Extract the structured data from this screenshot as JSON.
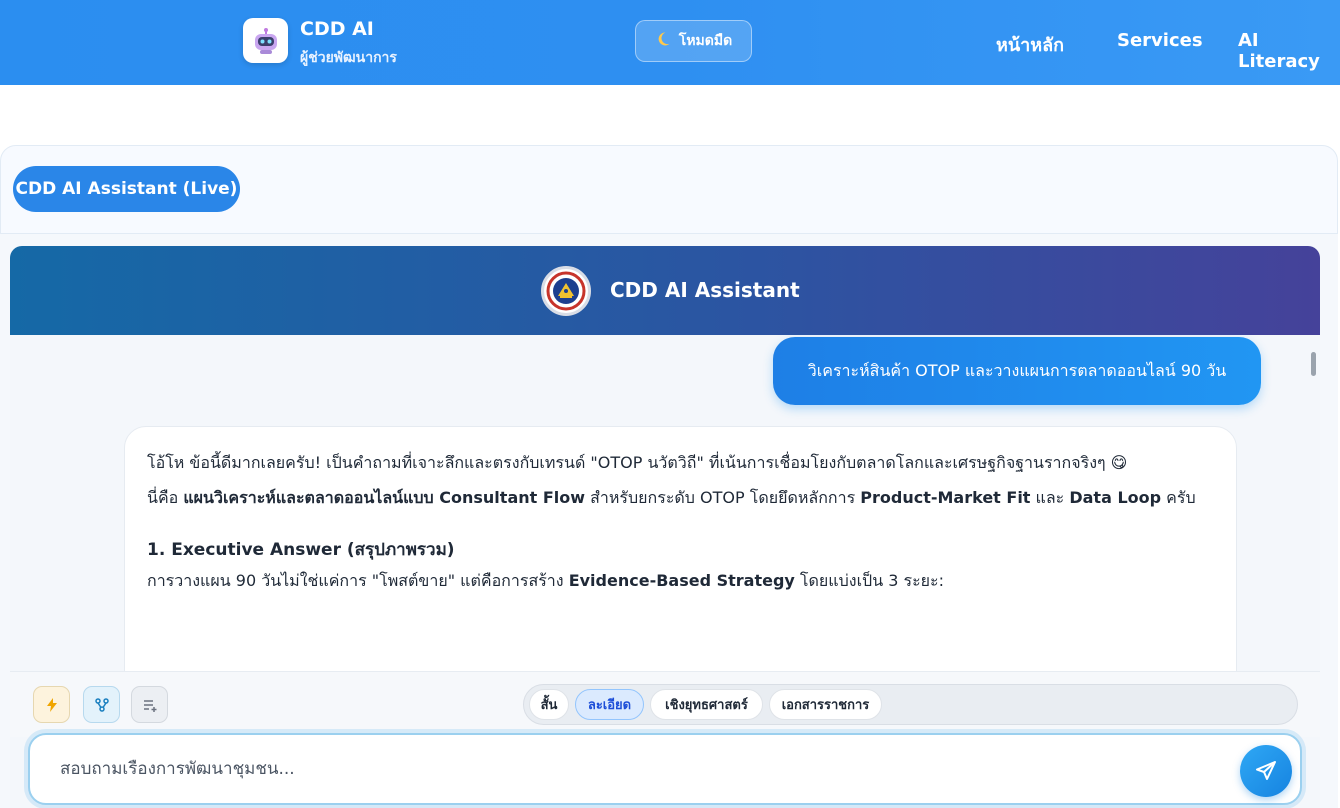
{
  "nav": {
    "brand_title": "CDD AI",
    "brand_subtitle": "ผู้ช่วยพัฒนาการ",
    "dark_mode_label": "โหมดมืด",
    "links": [
      "หน้าหลัก",
      "Services",
      "AI Literacy"
    ]
  },
  "page": {
    "live_pill": "CDD AI Assistant (Live)"
  },
  "chat": {
    "assistant_name": "CDD AI Assistant",
    "user_message": "วิเคราะห์สินค้า OTOP และวางแผนการตลาดออนไลน์ 90 วัน",
    "ai": {
      "p1": "โอ้โห ข้อนี้ดีมากเลยครับ! เป็นคำถามที่เจาะลึกและตรงกับเทรนด์ \"OTOP นวัตวิถี\" ที่เน้นการเชื่อมโยงกับตลาดโลกและเศรษฐกิจฐานรากจริงๆ 😋",
      "p2_a": "นี่คือ ",
      "p2_b": "แผนวิเคราะห์และตลาดออนไลน์แบบ Consultant Flow",
      "p2_c": " สำหรับยกระดับ OTOP โดยยึดหลักการ ",
      "p2_d": "Product-Market Fit",
      "p2_e": " และ ",
      "p2_f": "Data Loop",
      "p2_g": " ครับ",
      "h1": "1. Executive Answer (สรุปภาพรวม)",
      "p3_a": "การวางแผน 90 วันไม่ใช่แค่การ \"โพสต์ขาย\" แต่คือการสร้าง ",
      "p3_b": "Evidence-Based Strategy",
      "p3_c": " โดยแบ่งเป็น 3 ระยะ:"
    }
  },
  "toolbar": {
    "modes": [
      "สั้น",
      "ละเอียด",
      "เชิงยุทธศาสตร์",
      "เอกสารราชการ"
    ],
    "active_mode": "ละเอียด",
    "icons": [
      "bolt-icon",
      "branch-icon",
      "list-add-icon"
    ]
  },
  "input": {
    "placeholder": "สอบถามเรื่องการพัฒนาชุมชน..."
  },
  "colors": {
    "header_blue": "#2e8ff1",
    "accent": "#2196f3",
    "chat_header_start": "#1569a6",
    "chat_header_end": "#45429a"
  }
}
